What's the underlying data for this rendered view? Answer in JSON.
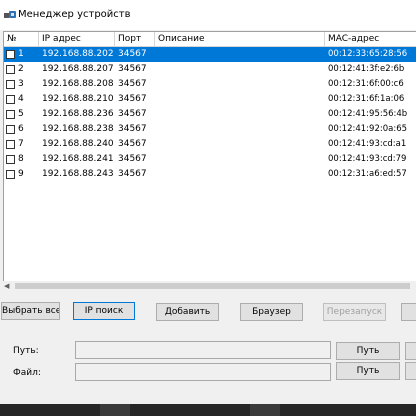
{
  "window": {
    "title": "Менеджер устройств"
  },
  "table": {
    "headers": {
      "num": "№",
      "ip": "IP адрес",
      "port": "Порт",
      "desc": "Описание",
      "mac": "MAC-адрес"
    },
    "rows": [
      {
        "num": "1",
        "ip": "192.168.88.202",
        "port": "34567",
        "desc": "",
        "mac": "00:12:33:65:28:56",
        "selected": true
      },
      {
        "num": "2",
        "ip": "192.168.88.207",
        "port": "34567",
        "desc": "",
        "mac": "00:12:41:3f:e2:6b",
        "selected": false
      },
      {
        "num": "3",
        "ip": "192.168.88.208",
        "port": "34567",
        "desc": "",
        "mac": "00:12:31:6f:00:c6",
        "selected": false
      },
      {
        "num": "4",
        "ip": "192.168.88.210",
        "port": "34567",
        "desc": "",
        "mac": "00:12:31:6f:1a:06",
        "selected": false
      },
      {
        "num": "5",
        "ip": "192.168.88.236",
        "port": "34567",
        "desc": "",
        "mac": "00:12:41:95:56:4b",
        "selected": false
      },
      {
        "num": "6",
        "ip": "192.168.88.238",
        "port": "34567",
        "desc": "",
        "mac": "00:12:41:92:0a:65",
        "selected": false
      },
      {
        "num": "7",
        "ip": "192.168.88.240",
        "port": "34567",
        "desc": "",
        "mac": "00:12:41:93:cd:a1",
        "selected": false
      },
      {
        "num": "8",
        "ip": "192.168.88.241",
        "port": "34567",
        "desc": "",
        "mac": "00:12:41:93:cd:79",
        "selected": false
      },
      {
        "num": "9",
        "ip": "192.168.88.243",
        "port": "34567",
        "desc": "",
        "mac": "00:12:31:a6:ed:57",
        "selected": false
      }
    ]
  },
  "buttons": {
    "select_all": "Выбрать все",
    "ip_search": "IP поиск",
    "add": "Добавить",
    "browser": "Браузер",
    "restart": "Перезапуск",
    "path_browse": "Путь",
    "file_browse": "Путь"
  },
  "fields": {
    "path_label": "Путь:",
    "path_value": "",
    "file_label": "Файл:",
    "file_value": ""
  },
  "colors": {
    "selection": "#0078d7",
    "window_bg": "#f0f0f0"
  }
}
